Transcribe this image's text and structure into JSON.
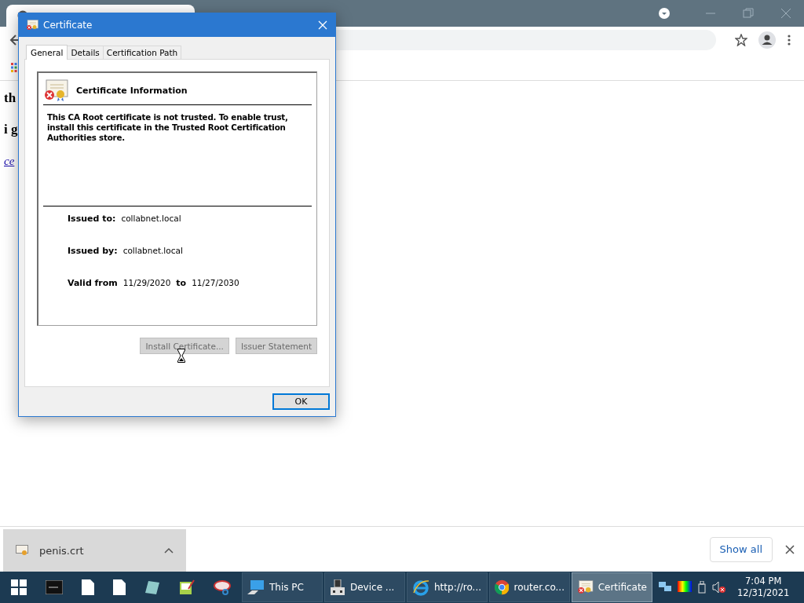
{
  "browser": {
    "page_text": [
      {
        "kind": "heading",
        "text": "th"
      },
      {
        "kind": "heading",
        "text": "i g"
      },
      {
        "kind": "link",
        "text": "ce"
      }
    ]
  },
  "dialog": {
    "title": "Certificate",
    "tabs": [
      {
        "label": "General",
        "selected": true
      },
      {
        "label": "Details",
        "selected": false
      },
      {
        "label": "Certification Path",
        "selected": false
      }
    ],
    "heading": "Certificate Information",
    "message": "This CA Root certificate is not trusted. To enable trust, install this certificate in the Trusted Root Certification Authorities store.",
    "fields": [
      {
        "label": "Issued to:",
        "value": "collabnet.local"
      },
      {
        "label": "Issued by:",
        "value": "collabnet.local"
      }
    ],
    "validity": {
      "label": "Valid from",
      "from": "11/29/2020",
      "separator": "to",
      "to": "11/27/2030"
    },
    "buttons": [
      {
        "label": "Install Certificate...",
        "disabled": true
      },
      {
        "label": "Issuer Statement",
        "disabled": true
      }
    ],
    "ok_button": "OK"
  },
  "download_bar": {
    "file": "penis.crt",
    "show_all": "Show all"
  },
  "taskbar": {
    "windows": [
      {
        "kind": "computer",
        "label": "This PC",
        "selected": false
      },
      {
        "kind": "device",
        "label": "Device ...",
        "selected": false
      },
      {
        "kind": "ie",
        "label": "http://ro...",
        "selected": false
      },
      {
        "kind": "chrome",
        "label": "router.co...",
        "selected": false
      },
      {
        "kind": "certificate",
        "label": "Certificate",
        "selected": true
      }
    ],
    "clock": {
      "time": "7:04 PM",
      "date": "12/31/2021"
    }
  }
}
